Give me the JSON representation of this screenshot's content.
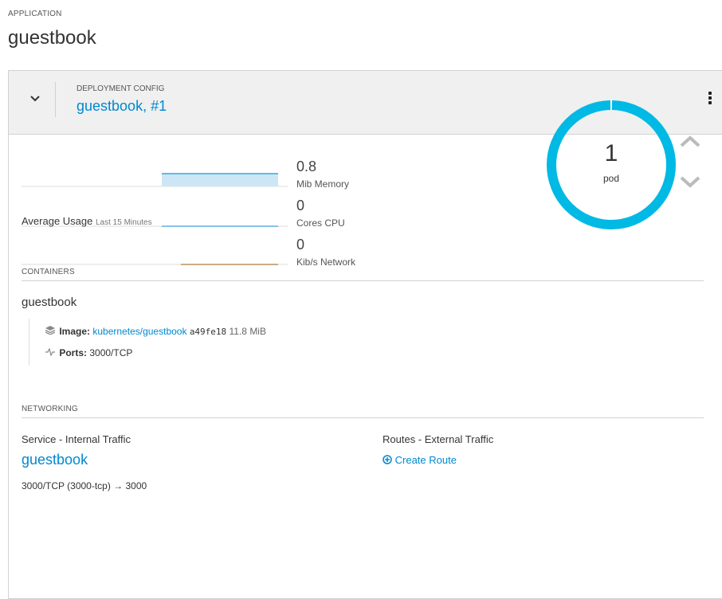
{
  "application": {
    "label": "APPLICATION",
    "name": "guestbook"
  },
  "deployment": {
    "label": "DEPLOYMENT CONFIG",
    "name": "guestbook, #1"
  },
  "metrics": [
    {
      "value": "0.8",
      "unit": "Mib Memory"
    },
    {
      "value": "0",
      "unit": "Cores CPU"
    },
    {
      "value": "0",
      "unit": "Kib/s Network"
    }
  ],
  "usage": {
    "label": "Average Usage",
    "range": "Last 15 Minutes"
  },
  "pods": {
    "count": "1",
    "label": "pod"
  },
  "containers": {
    "label": "CONTAINERS",
    "name": "guestbook",
    "image_label": "Image:",
    "image_name": "kubernetes/guestbook",
    "image_id": "a49fe18",
    "image_size": "11.8 MiB",
    "ports_label": "Ports:",
    "ports_value": "3000/TCP"
  },
  "networking": {
    "label": "NETWORKING",
    "service_label": "Service - Internal Traffic",
    "service_name": "guestbook",
    "service_port": "3000/TCP (3000-tcp) → 3000",
    "routes_label": "Routes - External Traffic",
    "create_route": "Create Route"
  },
  "colors": {
    "link": "#0088ce",
    "donut": "#00b9e4",
    "memory_fill": "#cde6f5",
    "memory_line": "#39a5dc",
    "network_line": "#b1793d"
  }
}
